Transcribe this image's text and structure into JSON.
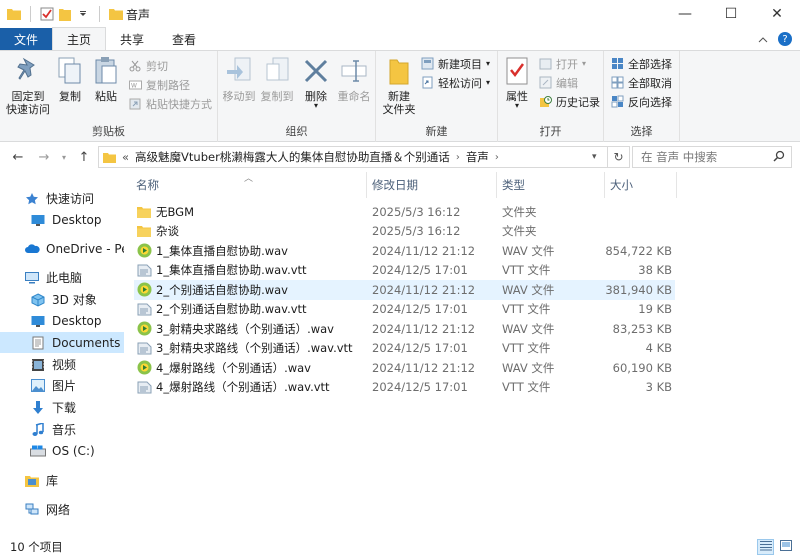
{
  "window": {
    "title": "音声",
    "minimize_glyph": "—",
    "maximize_glyph": "☐",
    "close_glyph": "✕"
  },
  "tabs": {
    "file": "文件",
    "home": "主页",
    "share": "共享",
    "view": "查看"
  },
  "ribbon": {
    "clipboard": {
      "label": "剪贴板",
      "pin": "固定到\n快速访问",
      "copy": "复制",
      "paste": "粘贴",
      "cut": "剪切",
      "copy_path": "复制路径",
      "paste_shortcut": "粘贴快捷方式"
    },
    "organize": {
      "label": "组织",
      "move_to": "移动到",
      "copy_to": "复制到",
      "delete": "删除",
      "rename": "重命名"
    },
    "new": {
      "label": "新建",
      "new_folder": "新建\n文件夹",
      "new_item": "新建项目",
      "easy_access": "轻松访问"
    },
    "open": {
      "label": "打开",
      "properties": "属性",
      "open": "打开",
      "edit": "编辑",
      "history": "历史记录"
    },
    "select": {
      "label": "选择",
      "select_all": "全部选择",
      "select_none": "全部取消",
      "invert": "反向选择"
    }
  },
  "address": {
    "prefix": "«",
    "crumbs": [
      "高级魅魔Vtuber桃濑梅露大人的集体自慰协助直播＆个别通话",
      "音声"
    ],
    "search_placeholder": "在 音声 中搜索"
  },
  "sidebar": {
    "items": [
      {
        "label": "快速访问",
        "icon": "star-icon"
      },
      {
        "label": "Desktop",
        "icon": "desktop-icon"
      },
      {
        "label": "OneDrive - Per",
        "icon": "cloud-icon"
      },
      {
        "label": "此电脑",
        "icon": "computer-icon"
      },
      {
        "label": "3D 对象",
        "icon": "cube-icon"
      },
      {
        "label": "Desktop",
        "icon": "desktop-icon"
      },
      {
        "label": "Documents",
        "icon": "documents-icon"
      },
      {
        "label": "视频",
        "icon": "video-icon"
      },
      {
        "label": "图片",
        "icon": "pictures-icon"
      },
      {
        "label": "下载",
        "icon": "download-icon"
      },
      {
        "label": "音乐",
        "icon": "music-icon"
      },
      {
        "label": "OS (C:)",
        "icon": "drive-icon"
      },
      {
        "label": "库",
        "icon": "library-icon"
      },
      {
        "label": "网络",
        "icon": "network-icon"
      }
    ]
  },
  "columns": {
    "name": "名称",
    "date": "修改日期",
    "type": "类型",
    "size": "大小"
  },
  "files": [
    {
      "name": "无BGM",
      "date": "2025/5/3 16:12",
      "type": "文件夹",
      "size": "",
      "kind": "folder"
    },
    {
      "name": "杂谈",
      "date": "2025/5/3 16:12",
      "type": "文件夹",
      "size": "",
      "kind": "folder"
    },
    {
      "name": "1_集体直播自慰协助.wav",
      "date": "2024/11/12 21:12",
      "type": "WAV 文件",
      "size": "854,722 KB",
      "kind": "wav"
    },
    {
      "name": "1_集体直播自慰协助.wav.vtt",
      "date": "2024/12/5 17:01",
      "type": "VTT 文件",
      "size": "38 KB",
      "kind": "vtt"
    },
    {
      "name": "2_个别通话自慰协助.wav",
      "date": "2024/11/12 21:12",
      "type": "WAV 文件",
      "size": "381,940 KB",
      "kind": "wav"
    },
    {
      "name": "2_个别通话自慰协助.wav.vtt",
      "date": "2024/12/5 17:01",
      "type": "VTT 文件",
      "size": "19 KB",
      "kind": "vtt"
    },
    {
      "name": "3_射精央求路线（个别通话）.wav",
      "date": "2024/11/12 21:12",
      "type": "WAV 文件",
      "size": "83,253 KB",
      "kind": "wav"
    },
    {
      "name": "3_射精央求路线（个别通话）.wav.vtt",
      "date": "2024/12/5 17:01",
      "type": "VTT 文件",
      "size": "4 KB",
      "kind": "vtt"
    },
    {
      "name": "4_爆射路线（个别通话）.wav",
      "date": "2024/11/12 21:12",
      "type": "WAV 文件",
      "size": "60,190 KB",
      "kind": "wav"
    },
    {
      "name": "4_爆射路线（个别通话）.wav.vtt",
      "date": "2024/12/5 17:01",
      "type": "VTT 文件",
      "size": "3 KB",
      "kind": "vtt"
    }
  ],
  "status": {
    "count": "10 个项目"
  },
  "colors": {
    "file_tab": "#1a5fa8",
    "selection": "#cce8ff",
    "row_hover": "#e5f3ff",
    "folder": "#f4c542"
  }
}
